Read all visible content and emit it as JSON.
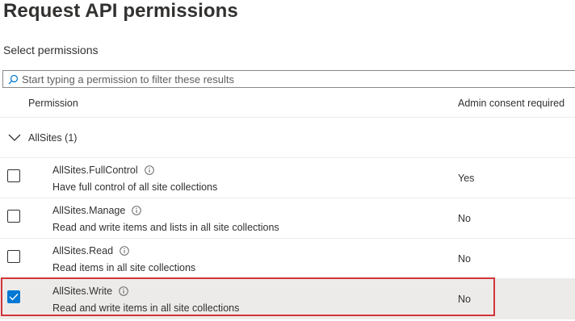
{
  "page": {
    "title": "Request API permissions",
    "section_label": "Select permissions"
  },
  "search": {
    "placeholder": "Start typing a permission to filter these results",
    "value": ""
  },
  "table": {
    "headers": {
      "permission": "Permission",
      "admin_consent": "Admin consent required"
    },
    "group": {
      "label": "AllSites (1)",
      "expanded": true
    },
    "rows": [
      {
        "name": "AllSites.FullControl",
        "description": "Have full control of all site collections",
        "admin_consent": "Yes",
        "checked": false
      },
      {
        "name": "AllSites.Manage",
        "description": "Read and write items and lists in all site collections",
        "admin_consent": "No",
        "checked": false
      },
      {
        "name": "AllSites.Read",
        "description": "Read items in all site collections",
        "admin_consent": "No",
        "checked": false
      },
      {
        "name": "AllSites.Write",
        "description": "Read and write items in all site collections",
        "admin_consent": "No",
        "checked": true
      }
    ]
  },
  "colors": {
    "accent": "#0078d4",
    "highlight_border": "#d13438",
    "selected_row_bg": "#edebe9"
  },
  "icons": {
    "search": "search-icon",
    "group_toggle": "chevron-down-icon",
    "info": "info-icon",
    "check": "checkmark-icon"
  }
}
